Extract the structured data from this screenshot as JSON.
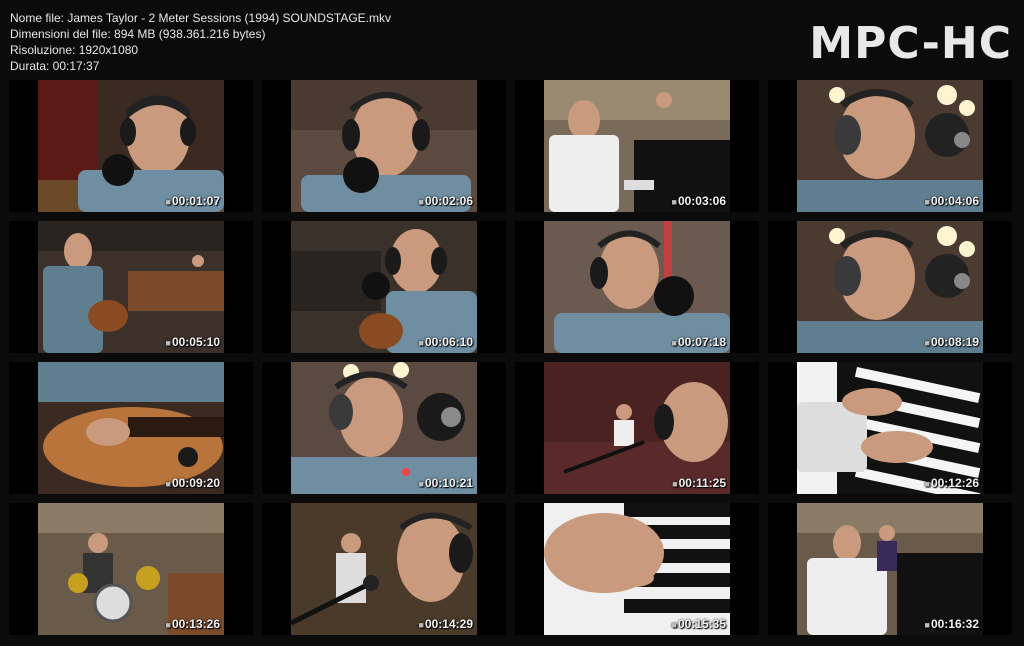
{
  "file_info": {
    "name": "Nome file: James Taylor - 2 Meter Sessions (1994) SOUNDSTAGE.mkv",
    "size": "Dimensioni del file: 894 MB (938.361.216 bytes)",
    "resolution": "Risoluzione: 1920x1080",
    "duration": "Durata: 00:17:37"
  },
  "brand": "MPC-HC",
  "thumbnails": [
    {
      "time": "00:01:07",
      "scene": "singer-closeup-left"
    },
    {
      "time": "00:02:06",
      "scene": "singer-front-mic"
    },
    {
      "time": "00:03:06",
      "scene": "pianist-studio"
    },
    {
      "time": "00:04:06",
      "scene": "singer-side-mic"
    },
    {
      "time": "00:05:10",
      "scene": "guitarist-studio-wide"
    },
    {
      "time": "00:06:10",
      "scene": "singer-guitar-mic"
    },
    {
      "time": "00:07:18",
      "scene": "singer-mic-front"
    },
    {
      "time": "00:08:19",
      "scene": "singer-side-mic"
    },
    {
      "time": "00:09:20",
      "scene": "guitar-hands"
    },
    {
      "time": "00:10:21",
      "scene": "singer-profile-mic"
    },
    {
      "time": "00:11:25",
      "scene": "singer-studio-red"
    },
    {
      "time": "00:12:26",
      "scene": "piano-hands"
    },
    {
      "time": "00:13:26",
      "scene": "drummer-studio"
    },
    {
      "time": "00:14:29",
      "scene": "singer-profile-band"
    },
    {
      "time": "00:15:35",
      "scene": "piano-keys-closeup"
    },
    {
      "time": "00:16:32",
      "scene": "pianist-band-wide"
    }
  ]
}
